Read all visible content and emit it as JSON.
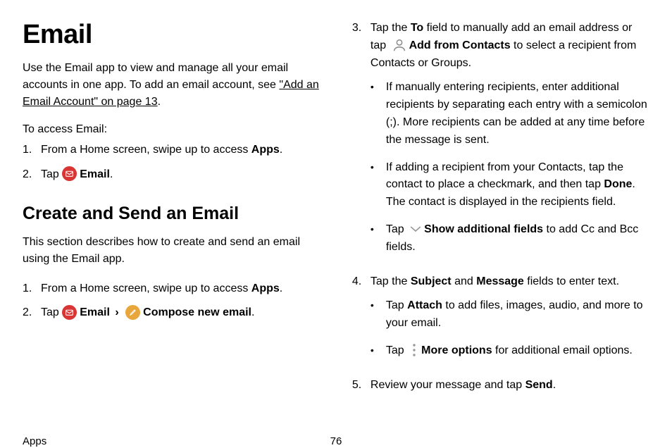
{
  "title": "Email",
  "intro_text": "Use the Email app to view and manage all your email accounts in one app. To add an email account, see ",
  "intro_link": "\"Add an Email Account\" on page 13",
  "intro_period": ".",
  "access_head": "To access Email:",
  "access_steps": {
    "s1_pre": "From a Home screen, swipe up to access ",
    "s1_bold": "Apps",
    "s1_post": ".",
    "s2_pre": "Tap ",
    "s2_bold": "Email",
    "s2_post": "."
  },
  "section_h2": "Create and Send an Email",
  "section_desc": "This section describes how to create and send an email using the Email app.",
  "create_steps": {
    "s1_pre": "From a Home screen, swipe up to access ",
    "s1_bold": "Apps",
    "s1_post": ".",
    "s2_pre": "Tap ",
    "s2_bold_email": "Email",
    "s2_sep": " › ",
    "s2_bold_compose": "Compose new email",
    "s2_post": "."
  },
  "right_steps": {
    "s3_pre": "Tap the ",
    "s3_bold_to": "To",
    "s3_mid1": " field to manually add an email address or tap ",
    "s3_bold_add": "Add from Contacts",
    "s3_post": " to select a recipient from Contacts or Groups.",
    "s3_bullets": {
      "b1": "If manually entering recipients, enter additional recipients by separating each entry with a semicolon (;). More recipients can be added at any time before the message is sent.",
      "b2_pre": "If adding a recipient from your Contacts, tap the contact to place a checkmark, and then tap ",
      "b2_bold": "Done",
      "b2_post": ". The contact is displayed in the recipients field.",
      "b3_pre": "Tap ",
      "b3_bold": "Show additional fields",
      "b3_post": " to add Cc and Bcc fields."
    },
    "s4_pre": "Tap the ",
    "s4_bold_subject": "Subject",
    "s4_mid": " and ",
    "s4_bold_message": "Message",
    "s4_post": " fields to enter text.",
    "s4_bullets": {
      "b1_pre": "Tap ",
      "b1_bold": "Attach",
      "b1_post": " to add files, images, audio, and more to your email.",
      "b2_pre": "Tap ",
      "b2_bold": "More options",
      "b2_post": " for additional email options."
    },
    "s5_pre": "Review your message and tap ",
    "s5_bold": "Send",
    "s5_post": "."
  },
  "numbers": {
    "n1": "1.",
    "n2": "2.",
    "n3": "3.",
    "n4": "4.",
    "n5": "5."
  },
  "bullet_glyph": "•",
  "footer_section": "Apps",
  "footer_page": "76"
}
